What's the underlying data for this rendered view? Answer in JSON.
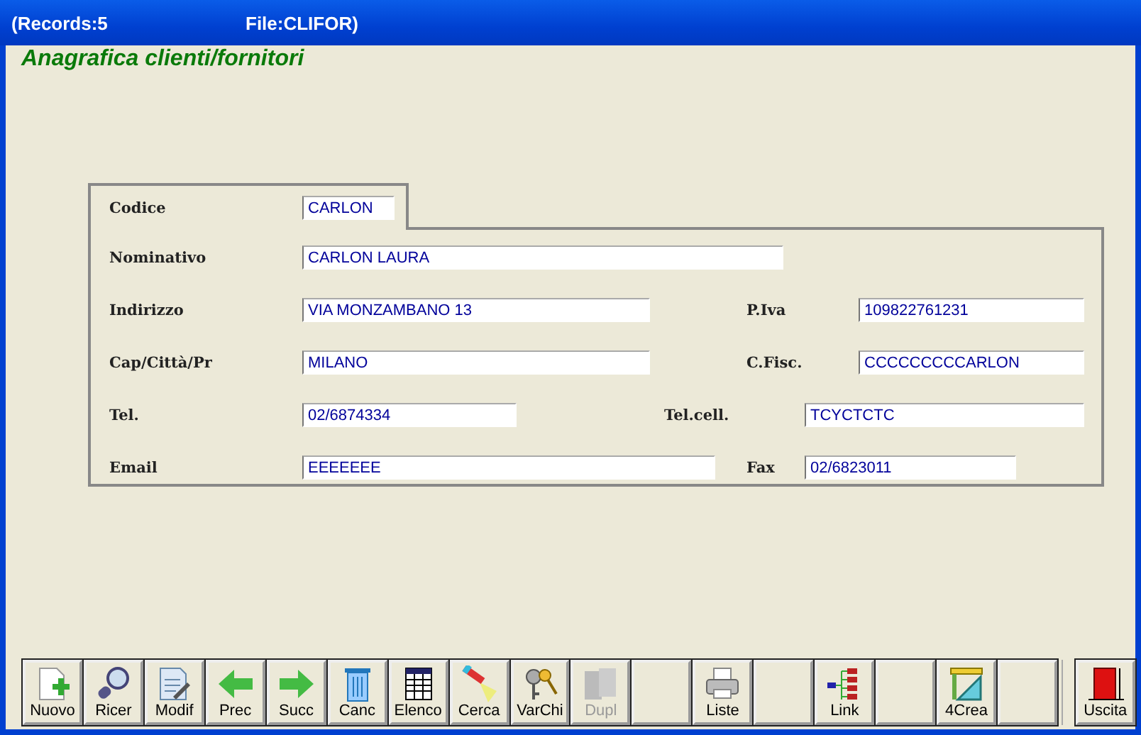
{
  "window": {
    "records": "(Records:5",
    "file": "File:CLIFOR)"
  },
  "heading": "Anagrafica clienti/fornitori",
  "code": {
    "label": "Codice",
    "value": "CARLON"
  },
  "rows": [
    {
      "fields": [
        {
          "label": "Nominativo",
          "value": "CARLON LAURA"
        }
      ]
    },
    {
      "fields": [
        {
          "label": "Indirizzo",
          "value": "VIA MONZAMBANO 13"
        },
        {
          "label": "P.Iva",
          "value": "109822761231"
        }
      ]
    },
    {
      "fields": [
        {
          "label": "Cap/Città/Pr",
          "value": "MILANO"
        },
        {
          "label": "C.Fisc.",
          "value": "CCCCCCCCCARLON"
        }
      ]
    },
    {
      "fields": [
        {
          "label": "Tel.",
          "value": "02/6874334"
        },
        {
          "label": "Tel.cell.",
          "value": "TCYCTCTC"
        }
      ]
    },
    {
      "fields": [
        {
          "label": "Email",
          "value": "EEEEEEE"
        },
        {
          "label": "Fax",
          "value": "02/6823011"
        }
      ]
    }
  ],
  "toolbar": [
    {
      "kind": "button",
      "label": "Nuovo",
      "disabled": false
    },
    {
      "kind": "button",
      "label": "Ricer",
      "disabled": false
    },
    {
      "kind": "button",
      "label": "Modif",
      "disabled": false
    },
    {
      "kind": "button",
      "label": "Prec",
      "disabled": false
    },
    {
      "kind": "button",
      "label": "Succ",
      "disabled": false
    },
    {
      "kind": "button",
      "label": "Canc",
      "disabled": false
    },
    {
      "kind": "button",
      "label": "Elenco",
      "disabled": false
    },
    {
      "kind": "button",
      "label": "Cerca",
      "disabled": false
    },
    {
      "kind": "button",
      "label": "VarChi",
      "disabled": false
    },
    {
      "kind": "button",
      "label": "Dupl",
      "disabled": true
    },
    {
      "kind": "blank"
    },
    {
      "kind": "button",
      "label": "Liste",
      "disabled": false
    },
    {
      "kind": "blank"
    },
    {
      "kind": "button",
      "label": "Link",
      "disabled": false
    },
    {
      "kind": "blank"
    },
    {
      "kind": "button",
      "label": "4Crea",
      "disabled": false
    },
    {
      "kind": "blank"
    },
    {
      "kind": "separator"
    },
    {
      "kind": "button",
      "label": "Uscita",
      "disabled": false
    }
  ]
}
